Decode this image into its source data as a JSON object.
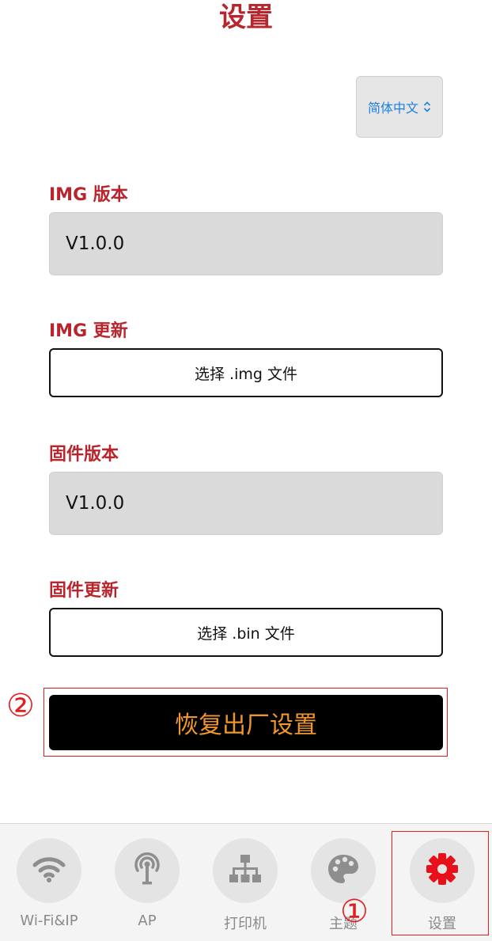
{
  "header": {
    "title": "设置"
  },
  "language": {
    "selected": "简体中文"
  },
  "img_version": {
    "label": "IMG 版本",
    "value": "V1.0.0"
  },
  "img_update": {
    "label": "IMG 更新",
    "button": "选择 .img 文件"
  },
  "firmware_version": {
    "label": "固件版本",
    "value": "V1.0.0"
  },
  "firmware_update": {
    "label": "固件更新",
    "button": "选择 .bin 文件"
  },
  "reset": {
    "label": "恢复出厂设置"
  },
  "annotations": {
    "one": "①",
    "two": "②"
  },
  "tabs": [
    {
      "label": "Wi-Fi&IP",
      "icon": "wifi-icon"
    },
    {
      "label": "AP",
      "icon": "antenna-icon"
    },
    {
      "label": "打印机",
      "icon": "network-tree-icon"
    },
    {
      "label": "主题",
      "icon": "palette-icon"
    },
    {
      "label": "设置",
      "icon": "gear-icon",
      "active": true
    }
  ],
  "colors": {
    "accent_red": "#b8252c",
    "select_blue": "#1e7fe0",
    "reset_text_orange": "#f0962a",
    "active_icon_red": "#e8101a",
    "annotation_red": "#e02020"
  }
}
